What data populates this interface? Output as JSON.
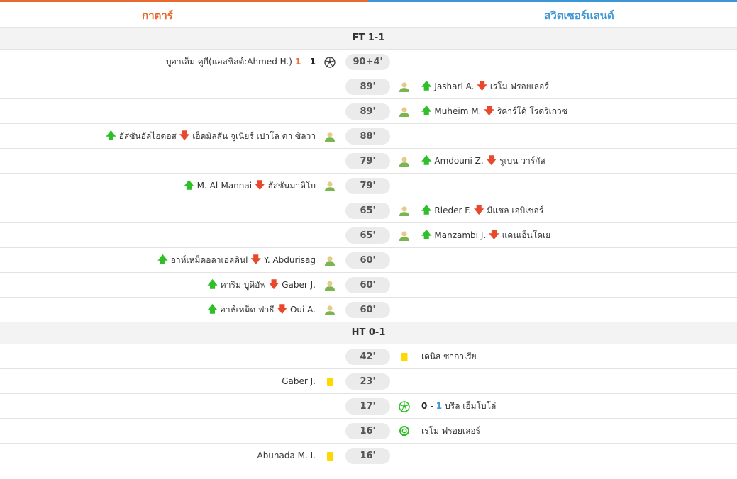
{
  "header": {
    "home_team": "กาตาร์",
    "away_team": "สวิตเซอร์แลนด์",
    "home_color": "#e8692d",
    "away_color": "#3d96d6"
  },
  "separators": {
    "full_time": "FT 1-1",
    "half_time": "HT 0-1"
  },
  "events": [
    {
      "minute": "90+4'",
      "side": "home",
      "type": "goal",
      "icon": "soccer-ball-icon",
      "text": "บูอาเล็ม คูกี(แอสซิสต์:Ahmed H.)",
      "score_home": "1",
      "dash": "-",
      "score_away": "1"
    },
    {
      "minute": "89'",
      "side": "away",
      "type": "sub",
      "icon": "player-substitution-icon",
      "player_in": "Jashari A.",
      "player_out": "เรโม ฟรอยเลอร์"
    },
    {
      "minute": "89'",
      "side": "away",
      "type": "sub",
      "icon": "player-substitution-icon",
      "player_in": "Muheim M.",
      "player_out": "ริคาร์โด้ โรดริเกวซ"
    },
    {
      "minute": "88'",
      "side": "home",
      "type": "sub",
      "icon": "player-substitution-icon",
      "player_in": "ฮัสซันอัลไฮดอส",
      "player_out": "เอ็ดมิลสัน จูเนียร์ เปาโล ดา ซิลวา"
    },
    {
      "minute": "79'",
      "side": "away",
      "type": "sub",
      "icon": "player-substitution-icon",
      "player_in": "Amdouni Z.",
      "player_out": "รูเบน วาร์กัส"
    },
    {
      "minute": "79'",
      "side": "home",
      "type": "sub",
      "icon": "player-substitution-icon",
      "player_in": "M. Al-Mannai",
      "player_out": "ฮัสซันมาดิโบ"
    },
    {
      "minute": "65'",
      "side": "away",
      "type": "sub",
      "icon": "player-substitution-icon",
      "player_in": "Rieder F.",
      "player_out": "มีแชล เอบิเชอร์"
    },
    {
      "minute": "65'",
      "side": "away",
      "type": "sub",
      "icon": "player-substitution-icon",
      "player_in": "Manzambi J.",
      "player_out": "แดนเอ็นโดเย"
    },
    {
      "minute": "60'",
      "side": "home",
      "type": "sub",
      "icon": "player-substitution-icon",
      "player_in": "อาห์เหม็ดอลาเอลดินl",
      "player_out": "Y. Abdurisag"
    },
    {
      "minute": "60'",
      "side": "home",
      "type": "sub",
      "icon": "player-substitution-icon",
      "player_in": "คาริม บูดิอัฟ",
      "player_out": "Gaber J."
    },
    {
      "minute": "60'",
      "side": "home",
      "type": "sub",
      "icon": "player-substitution-icon",
      "player_in": "อาห์เหม็ด ฟาธี",
      "player_out": "Oui A."
    }
  ],
  "first_half": [
    {
      "minute": "42'",
      "side": "away",
      "type": "yellow",
      "icon": "yellow-card-icon",
      "text": "เดนิส ซากาเรีย"
    },
    {
      "minute": "23'",
      "side": "home",
      "type": "yellow",
      "icon": "yellow-card-icon",
      "text": "Gaber J."
    },
    {
      "minute": "17'",
      "side": "away",
      "type": "goal",
      "icon": "soccer-ball-icon",
      "score_home": "0",
      "dash": "-",
      "score_away": "1",
      "text": "บรีล เอ็มโบโล่"
    },
    {
      "minute": "16'",
      "side": "away",
      "type": "penalty",
      "icon": "penalty-award-icon",
      "text": "เรโม ฟรอยเลอร์"
    },
    {
      "minute": "16'",
      "side": "home",
      "type": "yellow",
      "icon": "yellow-card-icon",
      "text": "Abunada M. I."
    }
  ]
}
